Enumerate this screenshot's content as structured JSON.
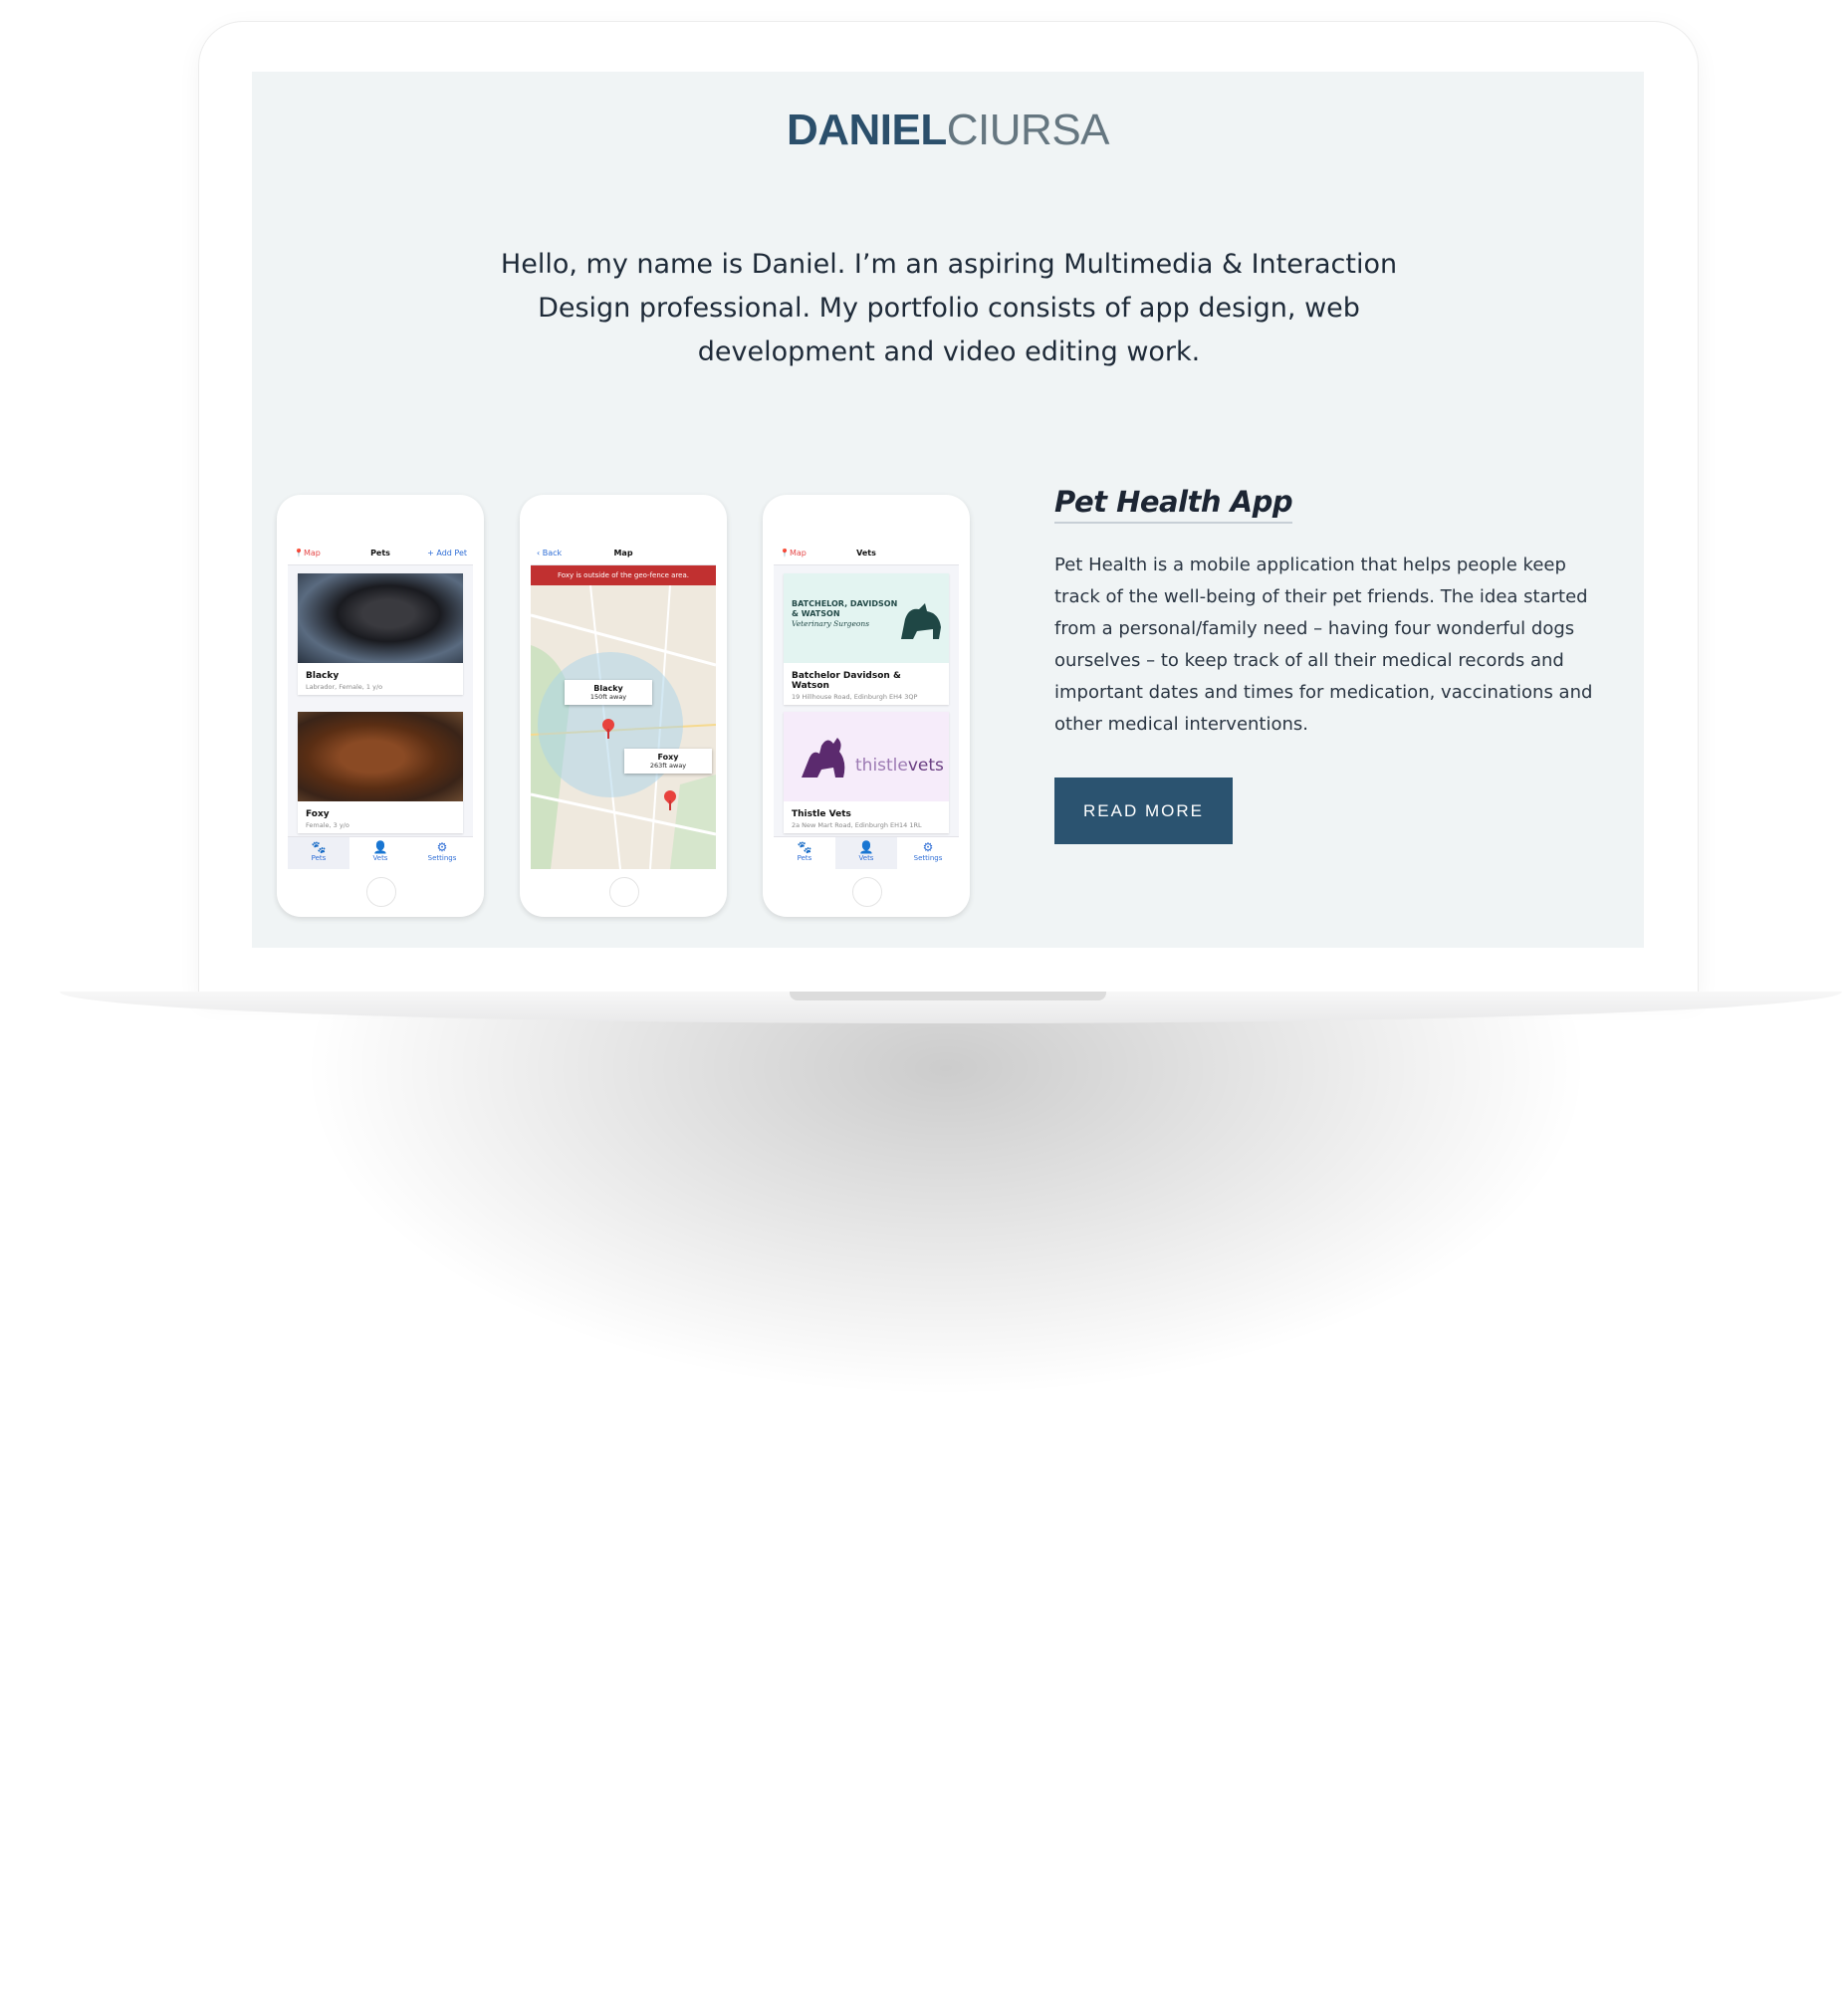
{
  "logo": {
    "first": "DANIEL",
    "last": "CIURSA"
  },
  "intro": "Hello, my name is Daniel. I’m an aspiring Multimedia & Interaction Design professional. My portfolio consists of app design, web development and video editing work.",
  "project": {
    "title": "Pet Health App",
    "description": "Pet Health is a mobile application that helps people keep track of the well-being of their pet friends. The idea started from a personal/family need – having four wonderful dogs ourselves – to keep track of all their medical records and important dates and times for medication, vaccinations and other medical interventions.",
    "button": "READ MORE"
  },
  "phones": {
    "pets": {
      "nav_left": "Map",
      "nav_title": "Pets",
      "nav_right": "+ Add Pet",
      "cards": [
        {
          "name": "Blacky",
          "detail": "Labrador, Female, 1 y/o"
        },
        {
          "name": "Foxy",
          "detail": "Female, 3 y/o"
        }
      ],
      "tabs": [
        "Pets",
        "Vets",
        "Settings"
      ]
    },
    "map": {
      "nav_left": "Back",
      "nav_title": "Map",
      "banner": "Foxy is outside of the geo-fence area.",
      "pins": [
        {
          "name": "Blacky",
          "distance": "150ft away"
        },
        {
          "name": "Foxy",
          "distance": "263ft away"
        }
      ]
    },
    "vets": {
      "nav_left": "Map",
      "nav_title": "Vets",
      "cards": [
        {
          "logo_line1": "BATCHELOR, DAVIDSON",
          "logo_line2": "& WATSON",
          "logo_sub": "Veterinary Surgeons",
          "name": "Batchelor Davidson & Watson",
          "address": "19 Hillhouse Road, Edinburgh EH4 3QP"
        },
        {
          "logo_a": "thistle",
          "logo_b": "vets",
          "name": "Thistle Vets",
          "address": "2a New Mart Road, Edinburgh EH14 1RL"
        }
      ],
      "tabs": [
        "Pets",
        "Vets",
        "Settings"
      ]
    }
  },
  "colors": {
    "brand": "#2b4f6b",
    "button": "#2b5370",
    "alert": "#c13030",
    "link": "#2f6ed6"
  }
}
